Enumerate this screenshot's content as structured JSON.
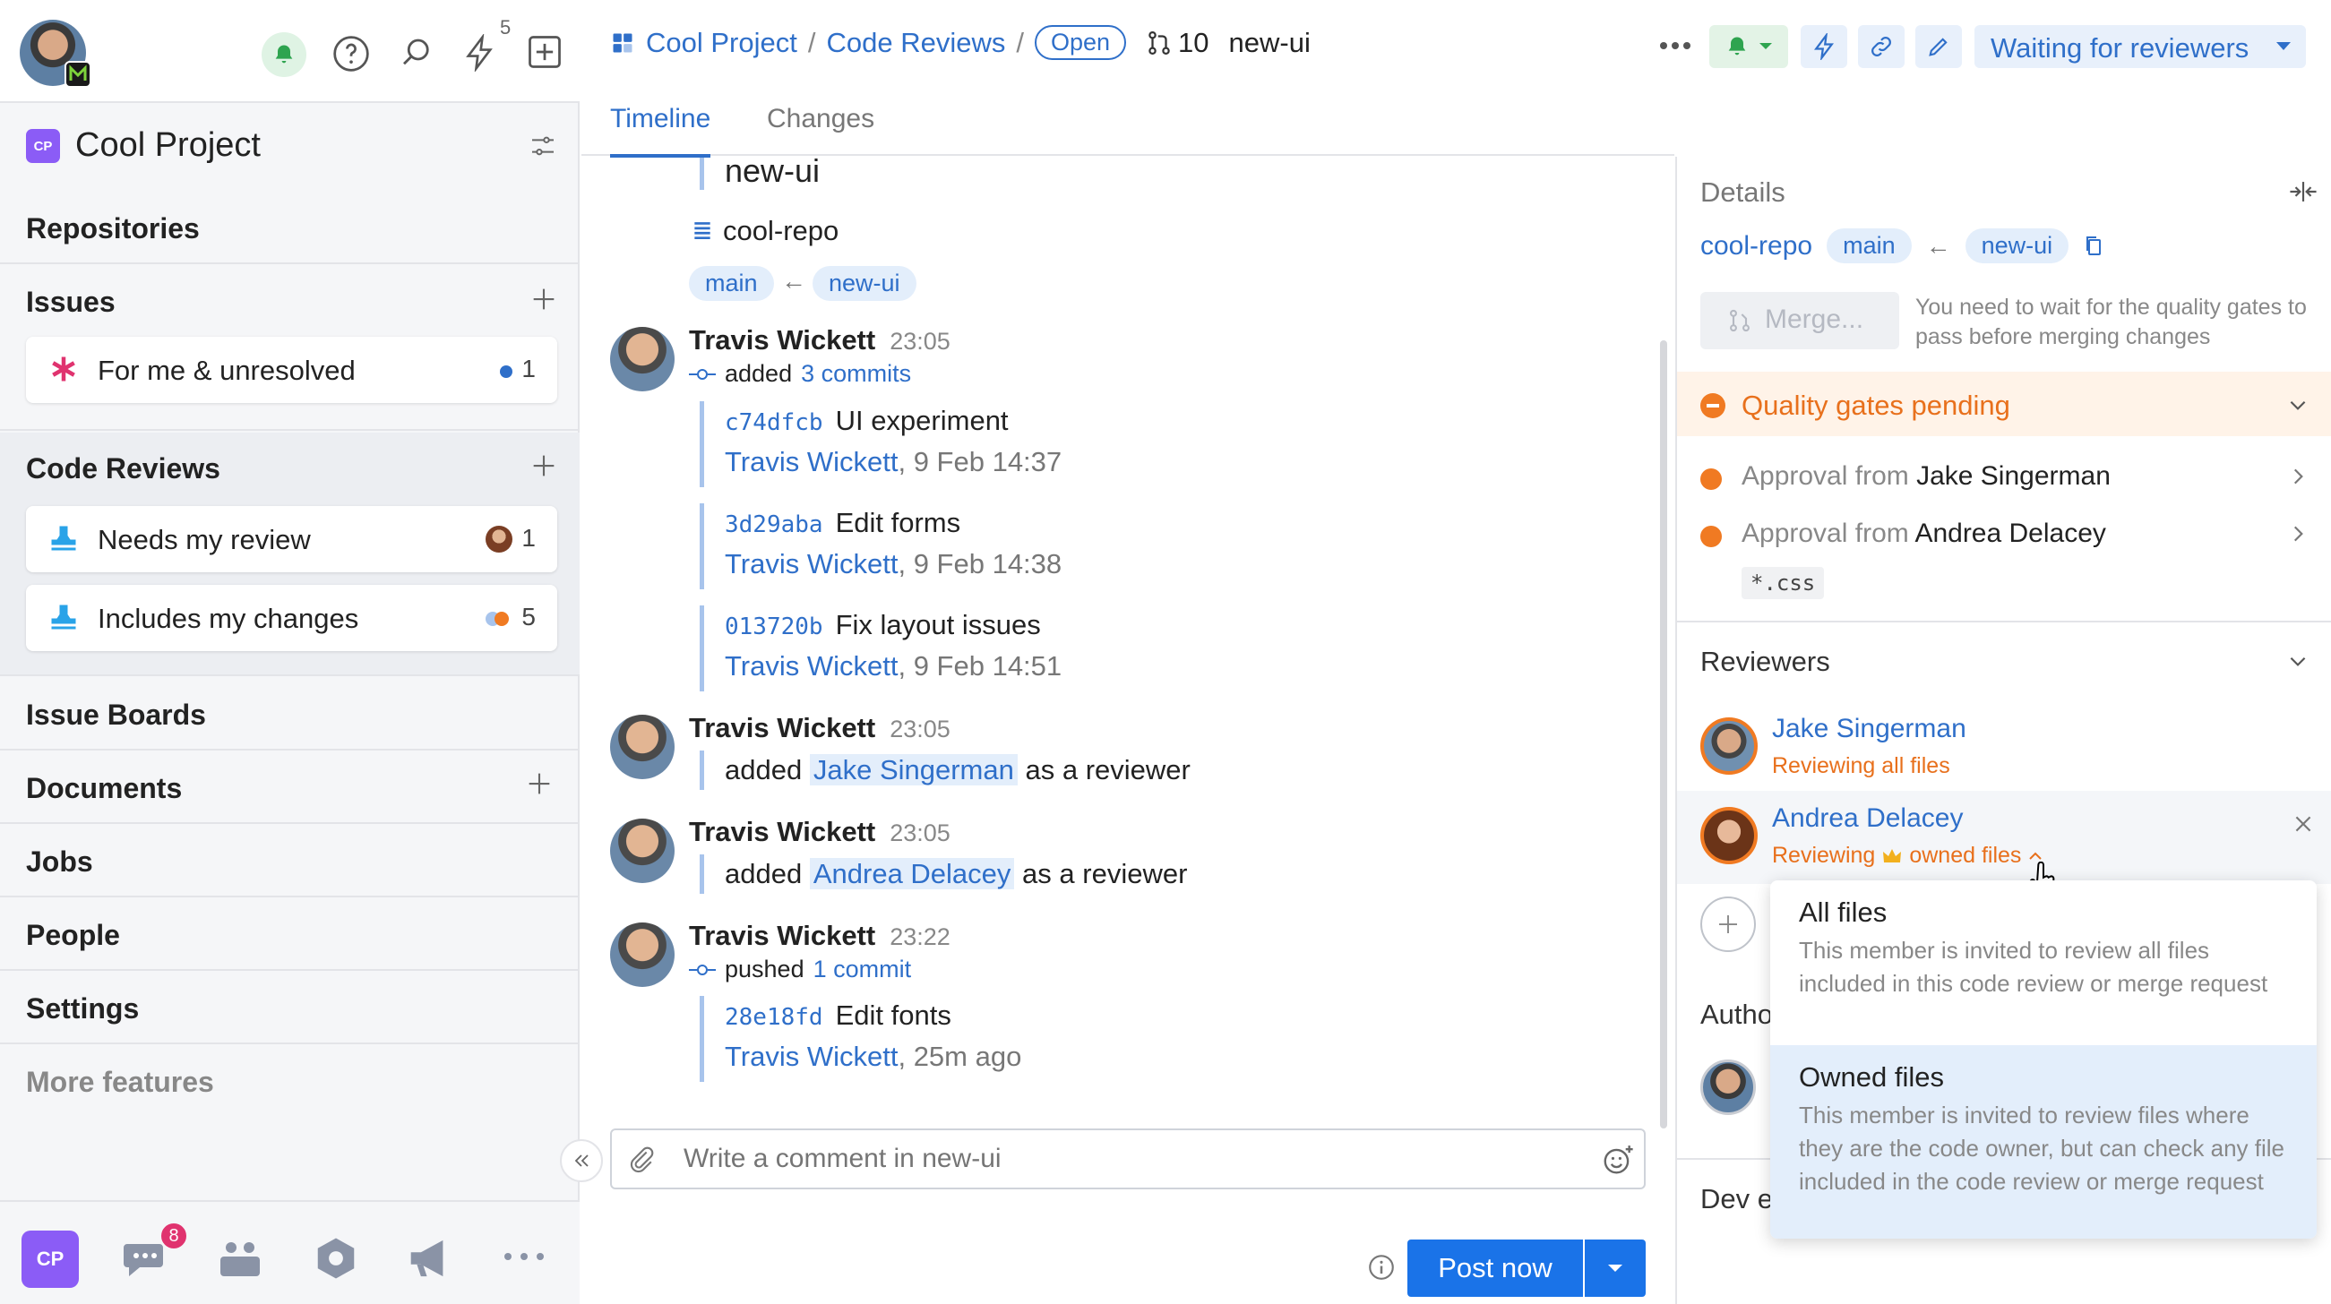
{
  "topbar": {
    "lightning_count": "5"
  },
  "sidebar": {
    "project_badge": "CP",
    "project_name": "Cool Project",
    "repositories": "Repositories",
    "issues": "Issues",
    "issues_item": {
      "label": "For me & unresolved",
      "count": "1"
    },
    "code_reviews": "Code Reviews",
    "code_review_items": [
      {
        "label": "Needs my review",
        "count": "1"
      },
      {
        "label": "Includes my changes",
        "count": "5"
      }
    ],
    "issue_boards": "Issue Boards",
    "documents": "Documents",
    "jobs": "Jobs",
    "people": "People",
    "settings": "Settings",
    "more_features": "More features",
    "bottom_badge": "CP",
    "chat_badge": "8"
  },
  "header": {
    "project": "Cool Project",
    "sep1": "/",
    "section": "Code Reviews",
    "sep2": "/",
    "status": "Open",
    "review_number": "10",
    "branch": "new-ui",
    "state_button": "Waiting for reviewers"
  },
  "tabs": {
    "timeline": "Timeline",
    "changes": "Changes"
  },
  "timeline": {
    "title_branch": "new-ui",
    "repo": "cool-repo",
    "target_branch": "main",
    "source_branch": "new-ui",
    "events": [
      {
        "author": "Travis Wickett",
        "time": "23:05",
        "action": "added",
        "link": "3 commits"
      },
      {
        "author": "Travis Wickett",
        "time": "23:05",
        "pre": "added",
        "person": "Jake Singerman",
        "post": "as a reviewer"
      },
      {
        "author": "Travis Wickett",
        "time": "23:05",
        "pre": "added",
        "person": "Andrea Delacey",
        "post": "as a reviewer"
      },
      {
        "author": "Travis Wickett",
        "time": "23:22",
        "action": "pushed",
        "link": "1 commit"
      }
    ],
    "commits": [
      {
        "hash": "c74dfcb",
        "msg": "UI experiment",
        "author": "Travis Wickett",
        "when": ", 9 Feb 14:37"
      },
      {
        "hash": "3d29aba",
        "msg": "Edit forms",
        "author": "Travis Wickett",
        "when": ", 9 Feb 14:38"
      },
      {
        "hash": "013720b",
        "msg": "Fix layout issues",
        "author": "Travis Wickett",
        "when": ", 9 Feb 14:51"
      },
      {
        "hash": "28e18fd",
        "msg": "Edit fonts",
        "author": "Travis Wickett",
        "when": ", 25m ago"
      }
    ]
  },
  "composer": {
    "placeholder": "Write a comment in new-ui",
    "post_button": "Post now"
  },
  "details": {
    "title": "Details",
    "repo": "cool-repo",
    "target": "main",
    "source": "new-ui",
    "merge_button": "Merge...",
    "merge_hint": "You need to wait for the quality gates to pass before merging changes",
    "quality_title": "Quality gates pending",
    "approvals": [
      {
        "prefix": "Approval from",
        "name": "Jake Singerman"
      },
      {
        "prefix": "Approval from",
        "name": "Andrea Delacey",
        "pattern": "*.css"
      }
    ],
    "reviewers_title": "Reviewers",
    "reviewers": [
      {
        "name": "Jake Singerman",
        "status": "Reviewing all files"
      },
      {
        "name": "Andrea Delacey",
        "status_pre": "Reviewing",
        "status_post": "owned files"
      }
    ],
    "authors_partial": "Autho",
    "dev_partial": "Dev e"
  },
  "dropdown": {
    "options": [
      {
        "title": "All files",
        "desc": "This member is invited to review all files included in this code review or merge request"
      },
      {
        "title": "Owned files",
        "desc": "This member is invited to review files where they are the code owner, but can check any file included in the code review or merge request"
      }
    ]
  },
  "colors": {
    "accent": "#2f6fc9",
    "warning": "#f07a22",
    "badge": "#8b5cf6"
  }
}
